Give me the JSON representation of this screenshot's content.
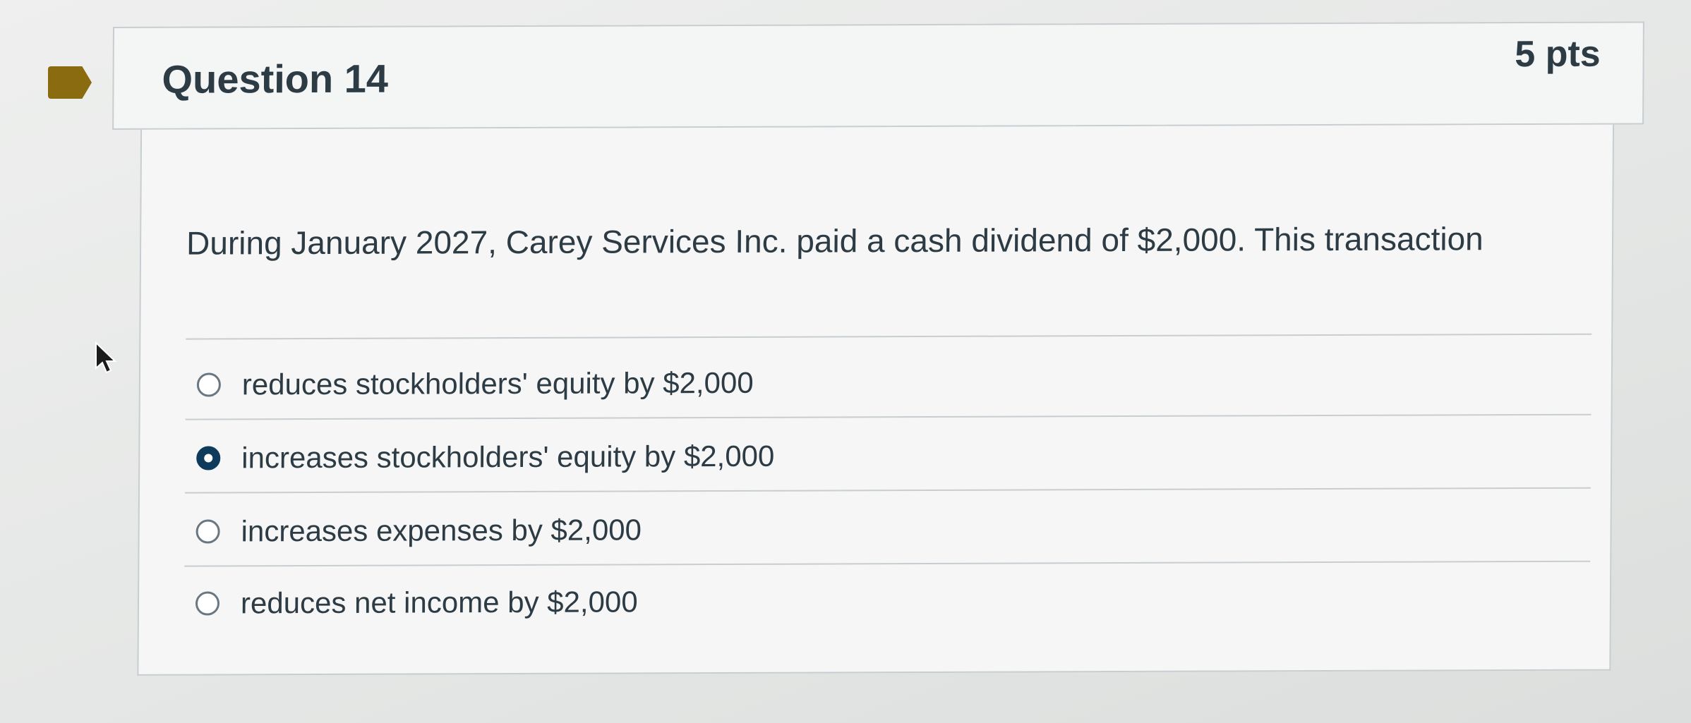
{
  "question": {
    "title": "Question 14",
    "points": "5 pts",
    "text": "During January 2027, Carey Services Inc. paid a cash dividend of $2,000. This transaction"
  },
  "answers": [
    {
      "label": "reduces stockholders' equity by $2,000",
      "selected": false
    },
    {
      "label": "increases stockholders' equity by $2,000",
      "selected": true
    },
    {
      "label": "increases expenses by $2,000",
      "selected": false
    },
    {
      "label": "reduces net income by $2,000",
      "selected": false
    }
  ],
  "colors": {
    "flag": "#8a6b10",
    "selected_radio": "#0e3a5c",
    "text": "#2d3b45"
  },
  "icons": {
    "flag": "bookmark-flag-icon",
    "cursor": "mouse-pointer-icon"
  }
}
